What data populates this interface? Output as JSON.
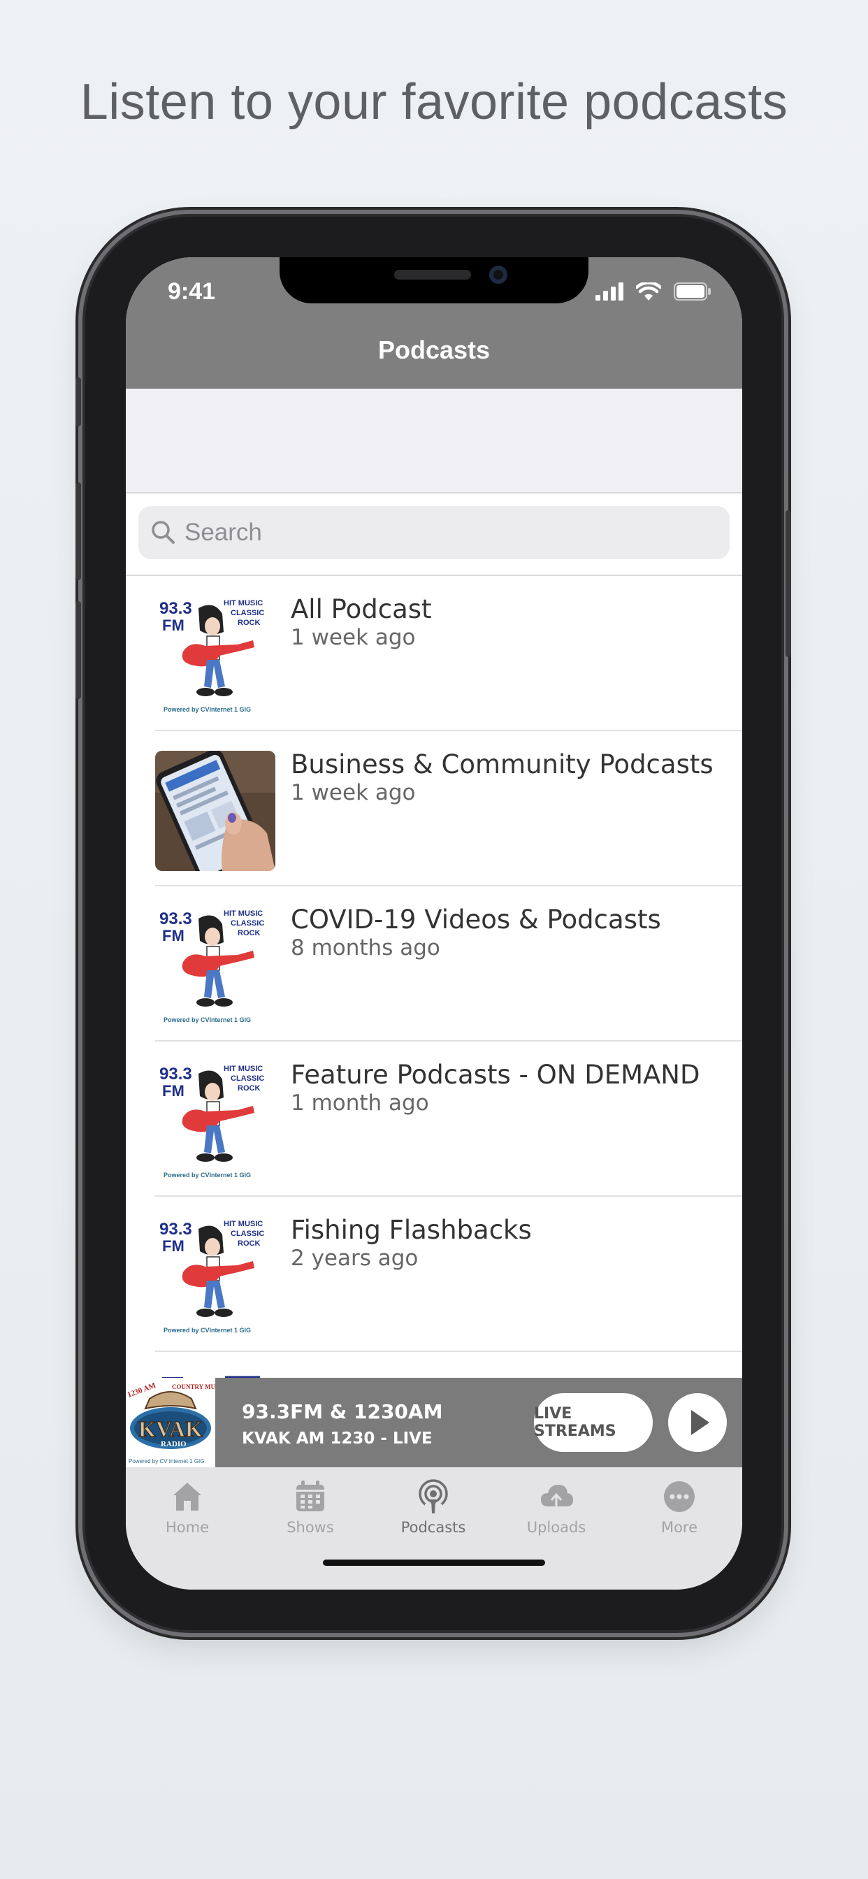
{
  "headline": "Listen to your favorite podcasts",
  "status_bar": {
    "time": "9:41"
  },
  "nav": {
    "title": "Podcasts"
  },
  "search": {
    "placeholder": "Search"
  },
  "podcasts": [
    {
      "title": "All Podcast",
      "updated": "1 week ago",
      "thumb": "station-logo"
    },
    {
      "title": "Business & Community Podcasts",
      "updated": "1 week ago",
      "thumb": "phone-photo"
    },
    {
      "title": "COVID-19 Videos & Podcasts",
      "updated": "8 months ago",
      "thumb": "station-logo"
    },
    {
      "title": "Feature Podcasts - ON DEMAND",
      "updated": "1 month ago",
      "thumb": "station-logo"
    },
    {
      "title": "Fishing Flashbacks",
      "updated": "2 years ago",
      "thumb": "station-logo"
    }
  ],
  "station_logo_text": {
    "freq": "93.3",
    "band": "FM",
    "tag1": "HIT MUSIC",
    "tag2": "CLASSIC",
    "tag3": "ROCK",
    "powered": "Powered by CVInternet 1 GIG"
  },
  "player": {
    "line1": "93.3FM & 1230AM",
    "line2": "KVAK AM 1230 - LIVE",
    "live_label": "LIVE STREAMS",
    "logo_text": {
      "top_left": "1230 AM",
      "top_right": "COUNTRY MUSIC",
      "name": "KVAK",
      "sub": "RADIO",
      "powered": "Powered by CV Internet 1 GIG"
    }
  },
  "tabs": [
    {
      "label": "Home",
      "icon": "home-icon",
      "active": false
    },
    {
      "label": "Shows",
      "icon": "calendar-icon",
      "active": false
    },
    {
      "label": "Podcasts",
      "icon": "podcast-icon",
      "active": true
    },
    {
      "label": "Uploads",
      "icon": "cloud-upload-icon",
      "active": false
    },
    {
      "label": "More",
      "icon": "more-icon",
      "active": false
    }
  ],
  "colors": {
    "nav_bg": "#7f7f7f",
    "player_bg": "#7b7b7b",
    "tabbar_bg": "#e4e4e6",
    "logo_blue": "#1f2f8a",
    "guitar_red": "#e03a3a"
  }
}
